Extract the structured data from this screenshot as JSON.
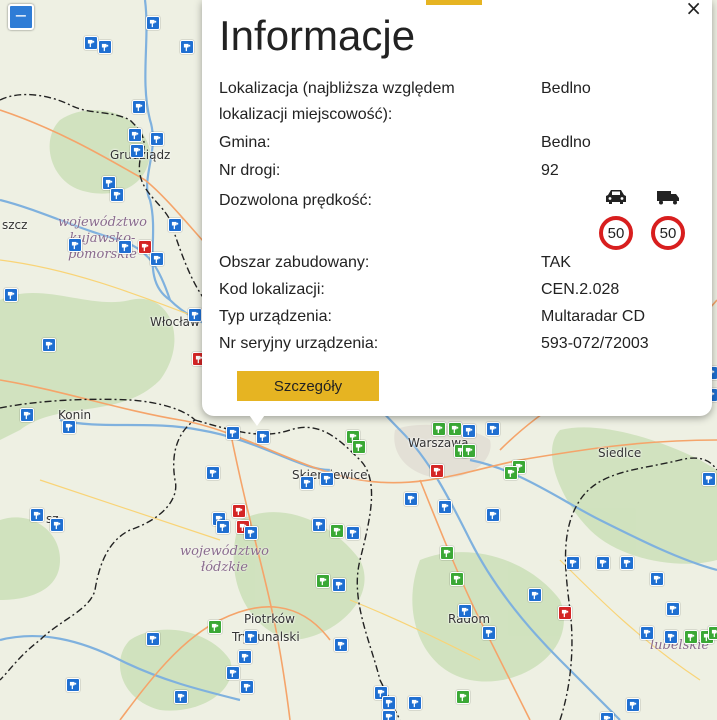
{
  "map": {
    "zoom_out_label": "−",
    "places": [
      {
        "name": "Grudziądz"
      },
      {
        "name": "szcz"
      },
      {
        "name": "Włocław"
      },
      {
        "name": "Konin"
      },
      {
        "name": "Skierniewice"
      },
      {
        "name": "Warszawa"
      },
      {
        "name": "Siedlce"
      },
      {
        "name": "Piotrków"
      },
      {
        "name": "Trybunalski"
      },
      {
        "name": "Radom"
      },
      {
        "name": "sz"
      }
    ],
    "regions": [
      {
        "name": "województwo kujawsko-pomorskie",
        "lines": [
          "województwo",
          "kujawsko-",
          "pomorskie"
        ]
      },
      {
        "name": "województwo łódzkie",
        "lines": [
          "województwo",
          "łódzkie"
        ]
      },
      {
        "name": "lubelskie",
        "lines": [
          "lubelskie"
        ]
      }
    ],
    "camera_colors": {
      "blue": "#1f6fd1",
      "green": "#3aa835",
      "red": "#d42525"
    }
  },
  "popup": {
    "title": "Informacje",
    "rows": [
      {
        "label": "Lokalizacja (najbliższa względem lokalizacji miejscowość):",
        "value": "Bedlno"
      },
      {
        "label": "Gmina:",
        "value": "Bedlno"
      },
      {
        "label": "Nr drogi:",
        "value": "92"
      },
      {
        "label": "Dozwolona prędkość:",
        "value": ""
      },
      {
        "label": "Obszar zabudowany:",
        "value": "TAK"
      },
      {
        "label": "Kod lokalizacji:",
        "value": "CEN.2.028"
      },
      {
        "label": "Typ urządzenia:",
        "value": "Multaradar CD"
      },
      {
        "label": "Nr seryjny urządzenia:",
        "value": "593-072/72003"
      }
    ],
    "speed_limits": [
      {
        "vehicle_icon": "car-icon",
        "value": "50"
      },
      {
        "vehicle_icon": "truck-icon",
        "value": "50"
      }
    ],
    "details_label": "Szczegóły",
    "close_label": "×",
    "accent_color": "#e6b422"
  }
}
